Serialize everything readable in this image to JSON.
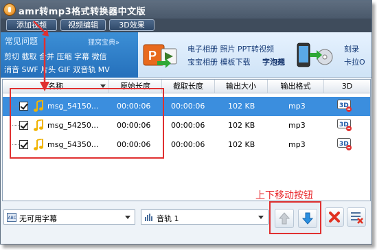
{
  "window": {
    "title": "amr转mp3格式转换器中文版"
  },
  "toolbar": {
    "add_video": "添加视频",
    "edit_video": "视频编辑",
    "effect_3d": "3D效果"
  },
  "faq": {
    "title": "常见问题",
    "more": "狸窝宝典»",
    "line1": "剪切 截取 合并 压缩 字幕 微信",
    "line2": "消音 SWF 片头 GIF 双音轨 MV"
  },
  "promo1": {
    "line1": "电子相册 照片 PPT转视频",
    "line2a": "宝宝相册 模板下载",
    "line2b": "字泡翘"
  },
  "promo2": {
    "line1": "刻录",
    "line2": "卡拉O"
  },
  "table": {
    "columns": [
      "名称",
      "原始长度",
      "截取长度",
      "输出大小",
      "输出格式",
      "3D"
    ],
    "rows": [
      {
        "name": "msg_54150...",
        "orig_len": "00:00:06",
        "cut_len": "00:00:06",
        "size": "102 KB",
        "format": "mp3",
        "selected": true
      },
      {
        "name": "msg_54250...",
        "orig_len": "00:00:06",
        "cut_len": "00:00:06",
        "size": "102 KB",
        "format": "mp3",
        "selected": false
      },
      {
        "name": "msg_54350...",
        "orig_len": "00:00:06",
        "cut_len": "00:00:06",
        "size": "102 KB",
        "format": "mp3",
        "selected": false
      }
    ]
  },
  "bottom": {
    "subtitle": "无可用字幕",
    "audio": "音轨 1"
  },
  "annotation": "上下移动按钮",
  "colors": {
    "accent": "#3b8ede",
    "annotation": "#e8262a",
    "titlebar": "#4a596b"
  }
}
